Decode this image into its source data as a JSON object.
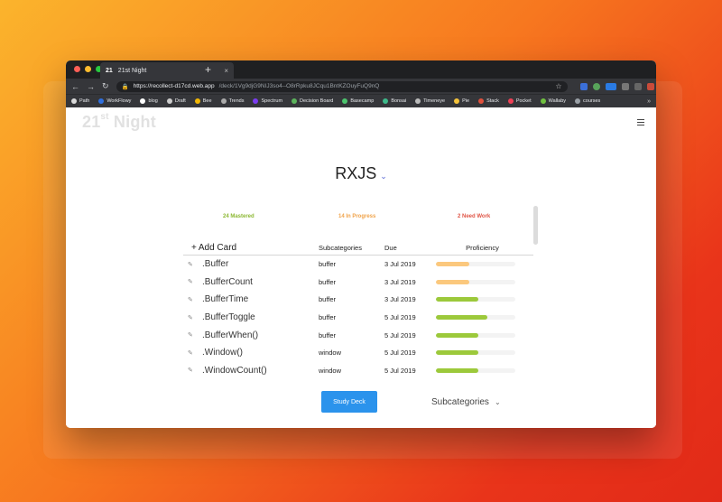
{
  "browser": {
    "tab_favicon": "21",
    "tab_title": "21st Night",
    "tab_close": "×",
    "new_tab": "+",
    "url_host": "https://recollect-d17cd.web.app",
    "url_path": "/deck/1Vg9djG9NIJ3so4--O8rRpku8JCqu1BntKZOuyFuQ9nQ",
    "bookmarks": [
      {
        "label": "Path",
        "color": "#d9d9d9"
      },
      {
        "label": "WorkFlowy",
        "color": "#2f6fde"
      },
      {
        "label": "blog",
        "color": "#ffffff"
      },
      {
        "label": "Draft",
        "color": "#cccccc"
      },
      {
        "label": "Bee",
        "color": "#f2b705"
      },
      {
        "label": "Trends",
        "color": "#aaaaaa"
      },
      {
        "label": "Spectrum",
        "color": "#7b3cf0"
      },
      {
        "label": "Decision Board",
        "color": "#5bb35b"
      },
      {
        "label": "Basecamp",
        "color": "#4cc46d"
      },
      {
        "label": "Bonsai",
        "color": "#3db98a"
      },
      {
        "label": "Timeneye",
        "color": "#bbbbbb"
      },
      {
        "label": "Pie",
        "color": "#f5c33b"
      },
      {
        "label": "Stack",
        "color": "#e0503c"
      },
      {
        "label": "Pocket",
        "color": "#ef4056"
      },
      {
        "label": "Wallaby",
        "color": "#70c040"
      },
      {
        "label": "courses",
        "color": "#9aa0a6"
      }
    ],
    "bookmarks_more": "»"
  },
  "app": {
    "logo_prefix": "21",
    "logo_sup": "st",
    "logo_suffix": " Night",
    "deck_title": "RXJS",
    "stats": {
      "mastered": "24 Mastered",
      "in_progress": "14 In Progress",
      "need_work": "2 Need Work"
    },
    "table": {
      "add_card": "Add Card",
      "col_subcategories": "Subcategories",
      "col_due": "Due",
      "col_proficiency": "Proficiency",
      "rows": [
        {
          "name": ".Buffer",
          "sub": "buffer",
          "due": "3 Jul 2019",
          "proficiency": 0.42,
          "color": "#fbc87d"
        },
        {
          "name": ".BufferCount",
          "sub": "buffer",
          "due": "3 Jul 2019",
          "proficiency": 0.42,
          "color": "#fbc87d"
        },
        {
          "name": ".BufferTime",
          "sub": "buffer",
          "due": "3 Jul 2019",
          "proficiency": 0.53,
          "color": "#9cc93b"
        },
        {
          "name": ".BufferToggle",
          "sub": "buffer",
          "due": "5 Jul 2019",
          "proficiency": 0.65,
          "color": "#9cc93b"
        },
        {
          "name": ".BufferWhen()",
          "sub": "buffer",
          "due": "5 Jul 2019",
          "proficiency": 0.53,
          "color": "#9cc93b"
        },
        {
          "name": ".Window()",
          "sub": "window",
          "due": "5 Jul 2019",
          "proficiency": 0.53,
          "color": "#9cc93b"
        },
        {
          "name": ".WindowCount()",
          "sub": "window",
          "due": "5 Jul 2019",
          "proficiency": 0.53,
          "color": "#9cc93b"
        }
      ]
    },
    "study_button": "Study Deck",
    "subcategories_dropdown": "Subcategories"
  },
  "colors": {
    "accent_blue": "#2b93ec",
    "mastered_green": "#8cb833",
    "progress_orange": "#f0a34a",
    "need_work_red": "#e05546"
  }
}
